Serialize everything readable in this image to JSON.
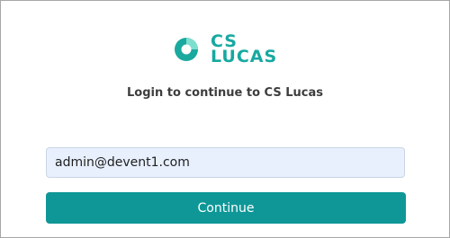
{
  "brand": {
    "line1": "CS",
    "line2": "LUCAS",
    "color": "#16a9a0",
    "mark_color_light": "#7fdfcf",
    "mark_color_dark": "#1aa99f"
  },
  "login": {
    "subtitle": "Login to continue to CS Lucas",
    "email_value": "admin@devent1.com",
    "continue_label": "Continue",
    "button_color": "#0f9797"
  }
}
